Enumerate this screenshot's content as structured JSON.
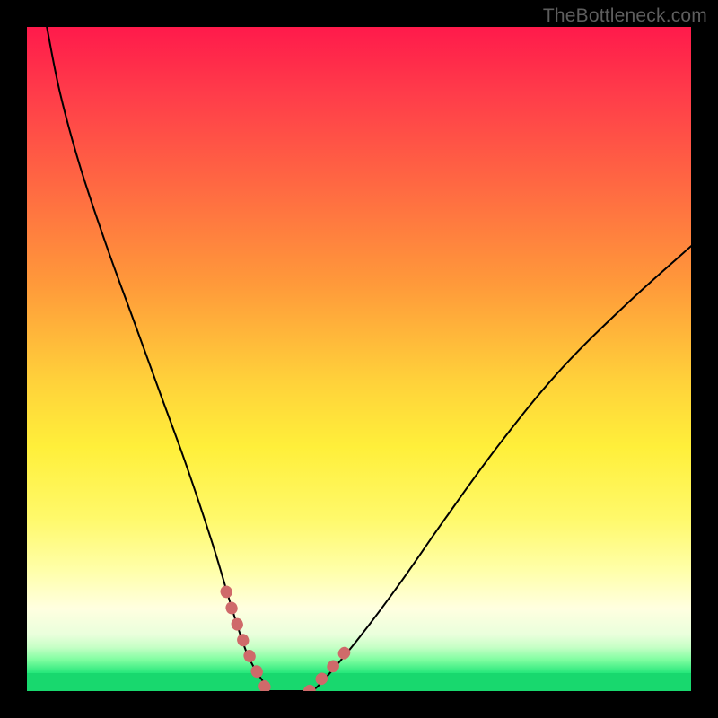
{
  "watermark": "TheBottleneck.com",
  "chart_data": {
    "type": "line",
    "title": "",
    "xlabel": "",
    "ylabel": "",
    "xlim": [
      0,
      100
    ],
    "ylim": [
      0,
      100
    ],
    "grid": false,
    "series": [
      {
        "name": "left-curve",
        "x": [
          3,
          5,
          8,
          12,
          16,
          20,
          24,
          28,
          31,
          33,
          34.5,
          35.5,
          36
        ],
        "y": [
          100,
          90,
          79,
          67,
          56,
          45,
          34,
          22,
          12,
          6,
          3,
          1.5,
          0
        ]
      },
      {
        "name": "valley-floor",
        "x": [
          36,
          38,
          40,
          42,
          43
        ],
        "y": [
          0,
          0,
          0,
          0,
          0
        ]
      },
      {
        "name": "right-curve",
        "x": [
          43,
          45,
          50,
          56,
          63,
          71,
          80,
          90,
          100
        ],
        "y": [
          0,
          2,
          8,
          16,
          26,
          37,
          48,
          58,
          67
        ]
      }
    ],
    "highlight_segments": [
      {
        "name": "left-tail-highlight",
        "x": [
          30,
          31.5,
          33,
          34.5,
          35.5,
          36.2
        ],
        "y": [
          15,
          10.5,
          6.5,
          3.2,
          1.2,
          0
        ]
      },
      {
        "name": "right-tail-highlight",
        "x": [
          42.5,
          43.5,
          45,
          46.5,
          48
        ],
        "y": [
          0,
          1,
          2.5,
          4.2,
          6
        ]
      }
    ],
    "colors": {
      "curve": "#000000",
      "highlight": "#cf6a6a"
    }
  }
}
